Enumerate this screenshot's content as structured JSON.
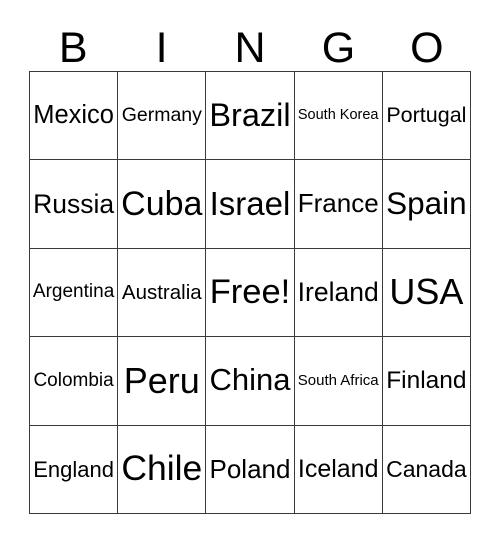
{
  "card": {
    "title": "BINGO",
    "header_letters": [
      "B",
      "I",
      "N",
      "G",
      "O"
    ],
    "colors": {
      "background": "#ffffff",
      "grid_line": "#3a3a3a",
      "text": "#000000"
    },
    "grid_size": "5x5",
    "free_space": "Free!",
    "free_space_position": "center",
    "rows": [
      [
        {
          "text": "Mexico"
        },
        {
          "text": "Germany"
        },
        {
          "text": "Brazil"
        },
        {
          "text": "South Korea"
        },
        {
          "text": "Portugal"
        }
      ],
      [
        {
          "text": "Russia"
        },
        {
          "text": "Cuba"
        },
        {
          "text": "Israel"
        },
        {
          "text": "France"
        },
        {
          "text": "Spain"
        }
      ],
      [
        {
          "text": "Argentina"
        },
        {
          "text": "Australia"
        },
        {
          "text": "Free!"
        },
        {
          "text": "Ireland"
        },
        {
          "text": "USA"
        }
      ],
      [
        {
          "text": "Colombia"
        },
        {
          "text": "Peru"
        },
        {
          "text": "China"
        },
        {
          "text": "South Africa"
        },
        {
          "text": "Finland"
        }
      ],
      [
        {
          "text": "England"
        },
        {
          "text": "Chile"
        },
        {
          "text": "Poland"
        },
        {
          "text": "Iceland"
        },
        {
          "text": "Canada"
        }
      ]
    ]
  }
}
